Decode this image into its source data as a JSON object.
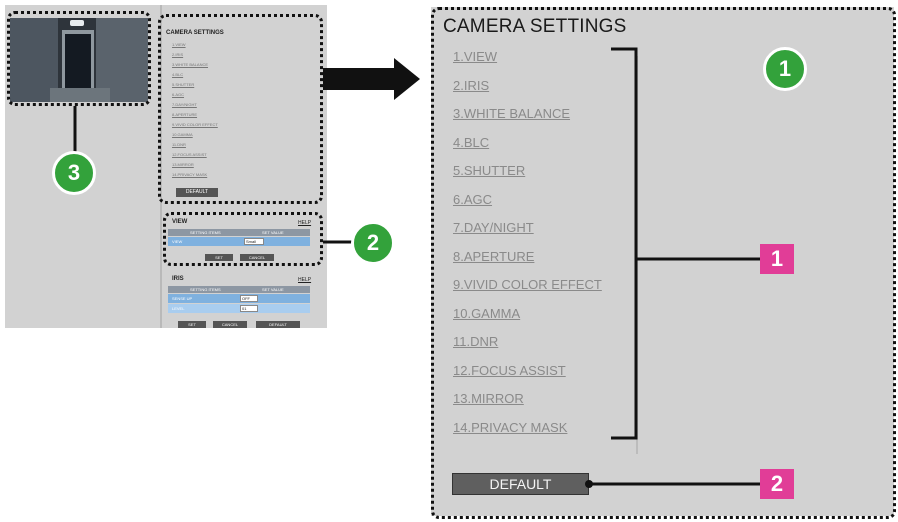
{
  "big_panel": {
    "title": "CAMERA SETTINGS",
    "menu_items": [
      "1.VIEW",
      "2.IRIS",
      "3.WHITE BALANCE",
      "4.BLC",
      "5.SHUTTER",
      "6.AGC",
      "7.DAY/NIGHT",
      "8.APERTURE",
      "9.VIVID COLOR EFFECT",
      "10.GAMMA",
      "11.DNR",
      "12.FOCUS ASSIST",
      "13.MIRROR",
      "14.PRIVACY MASK"
    ],
    "default_button": "DEFAULT"
  },
  "mini_panel": {
    "title": "CAMERA SETTINGS",
    "menu_items": [
      "1.VIEW",
      "2.IRIS",
      "3.WHITE BALANCE",
      "4.BLC",
      "5.SHUTTER",
      "6.AGC",
      "7.DAY/NIGHT",
      "8.APERTURE",
      "9.VIVID COLOR EFFECT",
      "10.GAMMA",
      "11.DNR",
      "12.FOCUS ASSIST",
      "13.MIRROR",
      "14.PRIVACY MASK"
    ],
    "default_button": "DEFAULT"
  },
  "view_panel": {
    "title": "VIEW",
    "help": "HELP",
    "col_items": "SETTING ITEMS",
    "col_value": "SET VALUE",
    "row_label": "VIEW",
    "row_value": "Small",
    "set_button": "SET",
    "cancel_button": "CANCEL"
  },
  "iris_panel": {
    "title": "IRIS",
    "help": "HELP",
    "col_items": "SETTING ITEMS",
    "col_value": "SET VALUE",
    "rows": [
      {
        "label": "SENSE UP",
        "value": "OFF"
      },
      {
        "label": "LEVEL",
        "value": "01"
      }
    ],
    "set_button": "SET",
    "cancel_button": "CANCEL",
    "default_button": "DEFAULT"
  },
  "callouts": {
    "green": [
      "1",
      "2",
      "3"
    ],
    "pink": [
      "1",
      "2"
    ]
  },
  "colors": {
    "panel_bg": "#d2d2d2",
    "green_badge": "#33a23b",
    "pink_badge": "#e13d97",
    "menu_link": "#8a8a8a",
    "button_bg": "#5f5f5f"
  }
}
